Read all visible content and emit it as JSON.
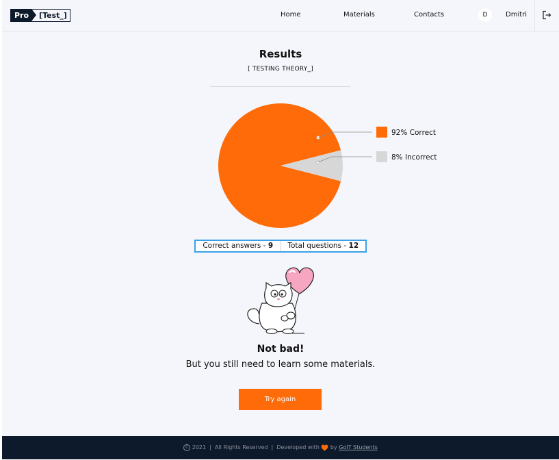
{
  "header": {
    "logo_pro": "Pro",
    "logo_test": "[Test_]",
    "nav": [
      "Home",
      "Materials",
      "Contacts"
    ],
    "avatar_initial": "D",
    "user_name": "Dmitri"
  },
  "results": {
    "title": "Results",
    "subtitle": "[ TESTING THEORY_]"
  },
  "chart_data": {
    "type": "pie",
    "slices": [
      {
        "label": "Correct",
        "value": 92,
        "color": "#ff6b08",
        "legend": "92% Correct"
      },
      {
        "label": "Incorrect",
        "value": 8,
        "color": "#d7d7d7",
        "legend": "8% Incorrect"
      }
    ]
  },
  "stats": {
    "correct_label": "Correct answers - ",
    "correct_value": "9",
    "total_label": "Total questions - ",
    "total_value": "12"
  },
  "message": {
    "headline": "Not bad!",
    "body": "But you still need to learn some materials."
  },
  "button": {
    "try_again": "Try again"
  },
  "footer": {
    "copyright_symbol": "C",
    "year": "2021",
    "rights": "All Rights Reserved",
    "developed": "Developed with",
    "by": "by",
    "team": "GoIT Students"
  },
  "colors": {
    "accent": "#ff6b08",
    "navy": "#0d1a2c",
    "highlight_border": "#3aa0e8"
  }
}
